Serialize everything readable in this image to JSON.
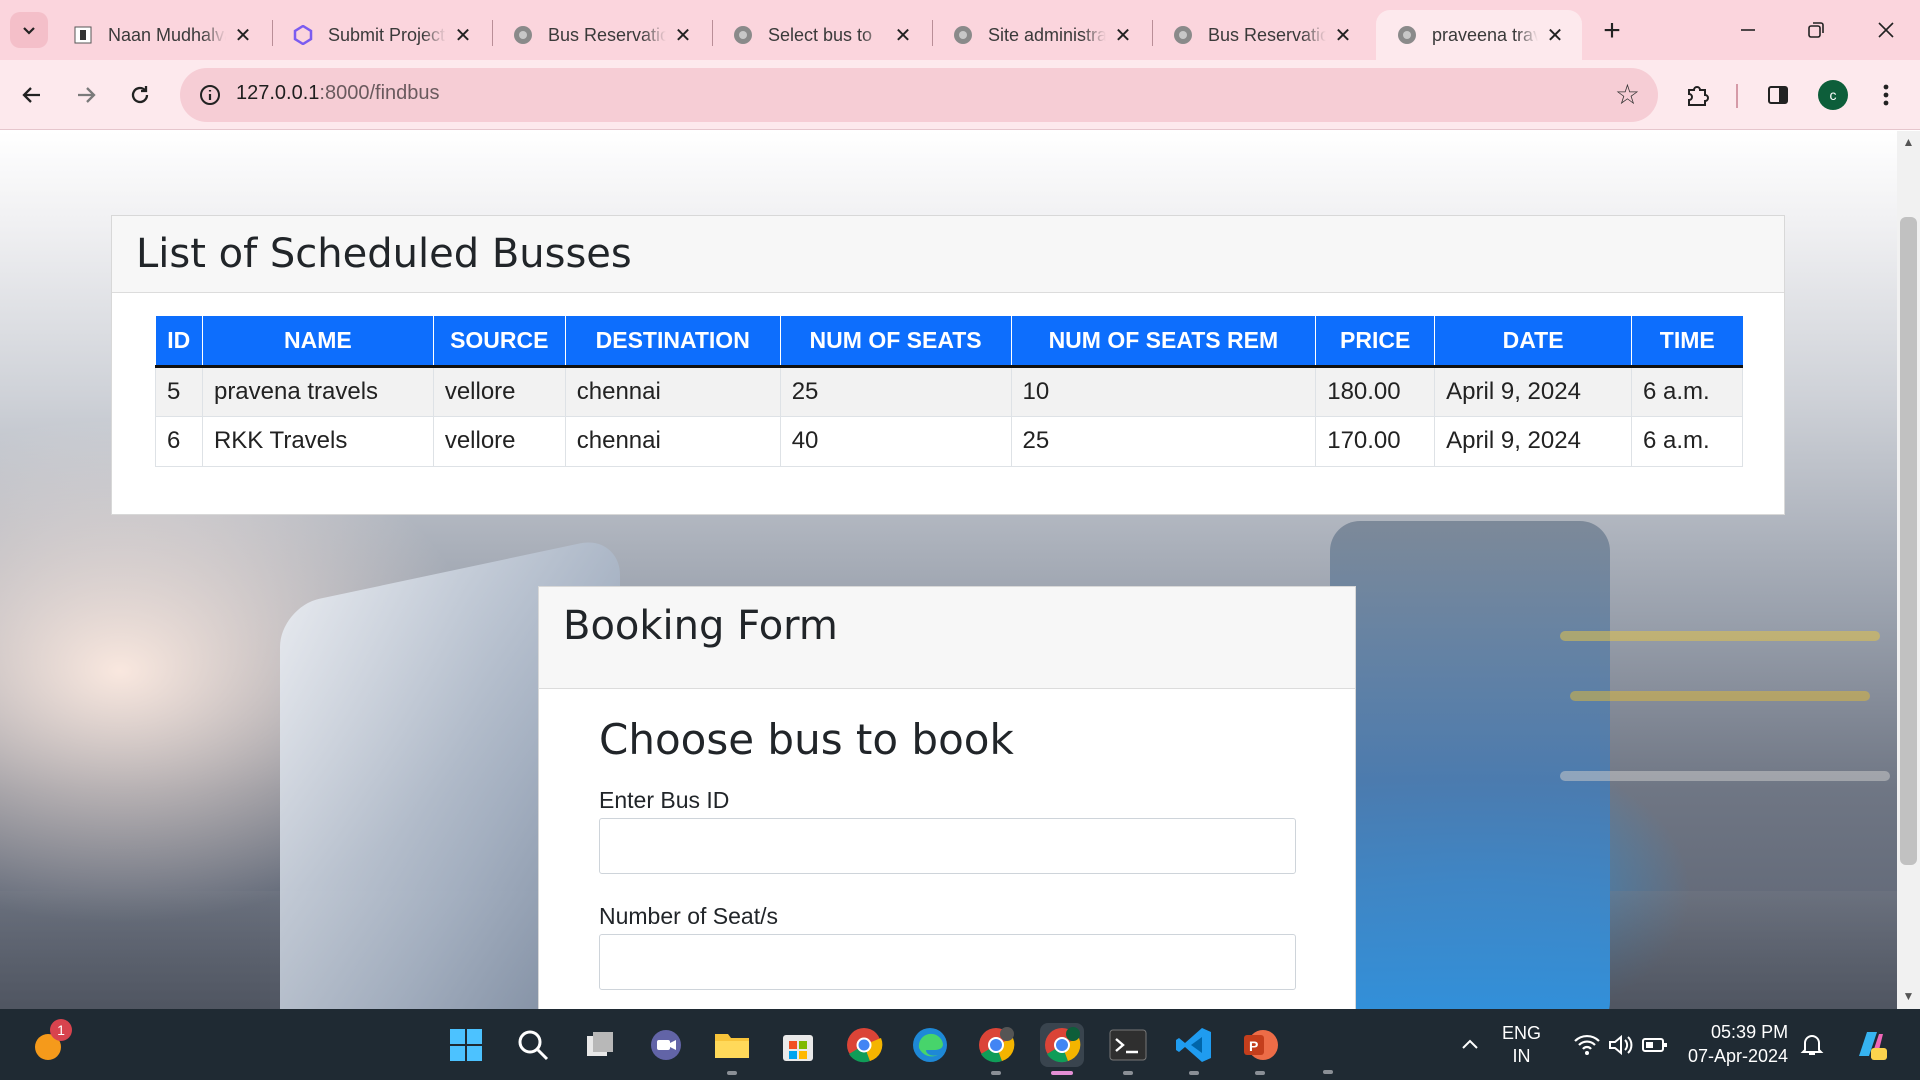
{
  "browser": {
    "tabs": [
      {
        "title": "Naan Mudhalvan",
        "icon": "naan-mudhalvan-favicon"
      },
      {
        "title": "Submit Project",
        "icon": "submit-project-favicon"
      },
      {
        "title": "Bus Reservation",
        "icon": "globe-favicon"
      },
      {
        "title": "Select bus to",
        "icon": "globe-favicon"
      },
      {
        "title": "Site administration",
        "icon": "globe-favicon"
      },
      {
        "title": "Bus Reservation",
        "icon": "globe-favicon"
      },
      {
        "title": "praveena travels",
        "icon": "globe-favicon",
        "active": true
      }
    ],
    "url_host": "127.0.0.1",
    "url_path": ":8000/findbus",
    "profile_initial": "c",
    "colors": {
      "tabstrip": "#fbd5dd",
      "toolbar": "#fde9ed",
      "accent": "#0d6efd"
    }
  },
  "page": {
    "list_title": "List of Scheduled Busses",
    "table": {
      "headers": [
        "ID",
        "NAME",
        "SOURCE",
        "DESTINATION",
        "NUM OF SEATS",
        "NUM OF SEATS REM",
        "PRICE",
        "DATE",
        "TIME"
      ],
      "rows": [
        [
          "5",
          "pravena travels",
          "vellore",
          "chennai",
          "25",
          "10",
          "180.00",
          "April 9, 2024",
          "6 a.m."
        ],
        [
          "6",
          "RKK Travels",
          "vellore",
          "chennai",
          "40",
          "25",
          "170.00",
          "April 9, 2024",
          "6 a.m."
        ]
      ]
    },
    "form": {
      "title": "Booking Form",
      "subtitle": "Choose bus to book",
      "bus_id_label": "Enter Bus ID",
      "bus_id_value": "",
      "seats_label": "Number of Seat/s",
      "seats_value": ""
    }
  },
  "taskbar": {
    "notification_badge": "1",
    "language_line1": "ENG",
    "language_line2": "IN",
    "time": "05:39 PM",
    "date": "07-Apr-2024",
    "pinned": [
      "start",
      "search",
      "task-view",
      "teams-meet",
      "file-explorer",
      "microsoft-store",
      "chrome",
      "edge",
      "chrome-profile-m",
      "chrome-profile-c",
      "terminal",
      "vscode",
      "powerpoint"
    ]
  }
}
